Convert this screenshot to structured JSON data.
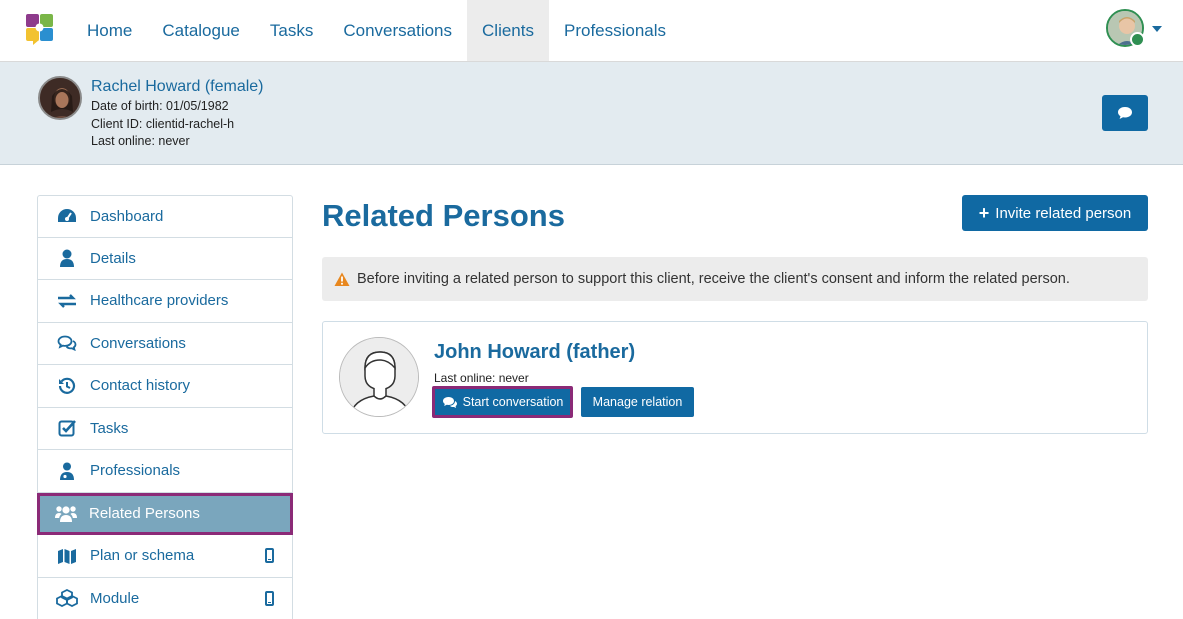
{
  "nav": {
    "items": [
      {
        "label": "Home"
      },
      {
        "label": "Catalogue"
      },
      {
        "label": "Tasks"
      },
      {
        "label": "Conversations"
      },
      {
        "label": "Clients",
        "active": true
      },
      {
        "label": "Professionals"
      }
    ]
  },
  "client": {
    "name": "Rachel Howard (female)",
    "dob": "Date of birth: 01/05/1982",
    "client_id": "Client ID: clientid-rachel-h",
    "last_online": "Last online: never"
  },
  "sidebar": {
    "items": [
      {
        "label": "Dashboard",
        "icon": "dashboard-icon"
      },
      {
        "label": "Details",
        "icon": "user-icon"
      },
      {
        "label": "Healthcare providers",
        "icon": "exchange-icon"
      },
      {
        "label": "Conversations",
        "icon": "comments-icon"
      },
      {
        "label": "Contact history",
        "icon": "history-icon"
      },
      {
        "label": "Tasks",
        "icon": "check-square-icon"
      },
      {
        "label": "Professionals",
        "icon": "doctor-icon"
      },
      {
        "label": "Related Persons",
        "icon": "users-icon",
        "active": true
      },
      {
        "label": "Plan or schema",
        "icon": "map-icon",
        "mobile": true
      },
      {
        "label": "Module",
        "icon": "cubes-icon",
        "mobile": true
      }
    ]
  },
  "main": {
    "title": "Related Persons",
    "invite_label": "Invite related person",
    "alert": "Before inviting a related person to support this client, receive the client's consent and inform the related person."
  },
  "related_person": {
    "name": "John Howard (father)",
    "last_online": "Last online: never",
    "start_label": "Start conversation",
    "manage_label": "Manage relation"
  },
  "colors": {
    "brand_blue": "#1069a3",
    "link_blue": "#1a6a9e",
    "highlight": "#8b2a77",
    "active_sidebar": "#7aa6bd",
    "header_bg": "#e3ebf0"
  }
}
